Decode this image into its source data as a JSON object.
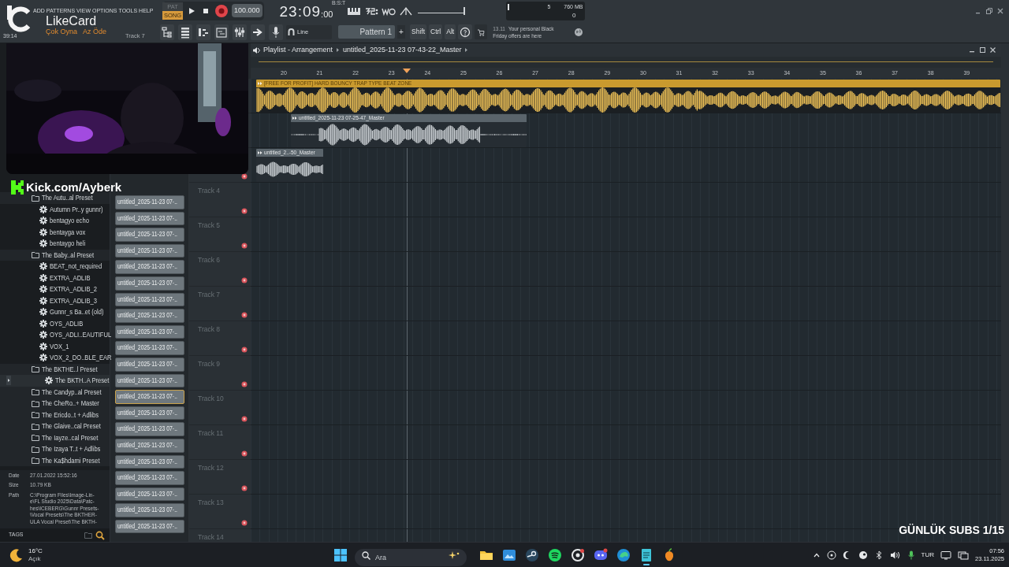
{
  "menu": [
    "ADD",
    "PATTERNS",
    "VIEW",
    "OPTIONS",
    "TOOLS",
    "HELP"
  ],
  "overlay_logo": {
    "name": "LikeCard",
    "tagline_1": "Çok Oyna",
    "tagline_2": "Az Öde"
  },
  "hint": {
    "time": "39:14",
    "track": "Track 7"
  },
  "transport": {
    "modes": [
      {
        "label": "PAT",
        "selected": false
      },
      {
        "label": "SONG",
        "selected": true
      }
    ],
    "tempo": "100.000",
    "time": "23:09",
    "time_small": ":00",
    "time_format": "B:S:T"
  },
  "master_slider": {
    "level": 0.97
  },
  "monitor": {
    "cpu": "5",
    "memory": "760 MB",
    "polyphony": "0"
  },
  "snap": "Line",
  "pattern": "Pattern 1",
  "pattern_add": "+",
  "modifiers": [
    "Shift",
    "Ctrl",
    "Alt"
  ],
  "news": {
    "date": "13.11",
    "text": "Your personal Black Friday offers are here"
  },
  "browser": {
    "items": [
      {
        "kind": "folder",
        "label": "The Autu..al Preset",
        "selected": false,
        "children": [
          {
            "kind": "preset",
            "label": "Autumn Pr..y gunnr)",
            "selected": false
          },
          {
            "kind": "preset",
            "label": "bentagyo echo",
            "selected": false
          },
          {
            "kind": "preset",
            "label": "bentayga vox",
            "selected": false
          },
          {
            "kind": "preset",
            "label": "bentaygo heli",
            "selected": false
          }
        ]
      },
      {
        "kind": "folder",
        "label": "The Baby..al Preset",
        "selected": false,
        "children": [
          {
            "kind": "preset",
            "label": "BEAT_not_required",
            "selected": false
          },
          {
            "kind": "preset",
            "label": "EXTRA_ADLIB",
            "selected": false
          },
          {
            "kind": "preset",
            "label": "EXTRA_ADLIB_2",
            "selected": false
          },
          {
            "kind": "preset",
            "label": "EXTRA_ADLIB_3",
            "selected": false
          },
          {
            "kind": "preset",
            "label": "Gunnr_s Ba..et (old)",
            "selected": false
          },
          {
            "kind": "preset",
            "label": "OYS_ADLIB",
            "selected": false
          },
          {
            "kind": "preset",
            "label": "OYS_ADLI..EAUTIFUL",
            "selected": false
          },
          {
            "kind": "preset",
            "label": "VOX_1",
            "selected": false
          },
          {
            "kind": "preset",
            "label": "VOX_2_DO..BLE_EAR",
            "selected": false
          }
        ]
      },
      {
        "kind": "folder",
        "label": "The BKTHE..l Preset",
        "selected": false,
        "children": [
          {
            "kind": "preset",
            "label": "The BKTH..A Preset",
            "selected": true
          }
        ]
      },
      {
        "kind": "folder",
        "label": "The Candyp..al Preset",
        "selected": false
      },
      {
        "kind": "folder",
        "label": "The CheRo..+ Master",
        "selected": false
      },
      {
        "kind": "folder",
        "label": "The Ericdo..t + Adlibs",
        "selected": false
      },
      {
        "kind": "folder",
        "label": "The Glaive..cal Preset",
        "selected": false
      },
      {
        "kind": "folder",
        "label": "The Iayze..cal Preset",
        "selected": false
      },
      {
        "kind": "folder",
        "label": "The Izaya T..t + Adlibs",
        "selected": false
      },
      {
        "kind": "folder",
        "label": "The Ka$hdami Preset",
        "selected": false
      }
    ],
    "info": {
      "date_label": "Date",
      "date": "27.01.2022 15:52:16",
      "size_label": "Size",
      "size": "10.79 KB",
      "path_label": "Path",
      "path_lines": [
        "C:\\Program Files\\Image-Lin-",
        "e\\FL Studio 2025\\Data\\Patc-",
        "hes\\ICEBERG\\Gunnr Presets-",
        "\\Vocal Presets\\The BKTHER-",
        "ULA Vocal Preset\\The BKTH-"
      ]
    },
    "tags": "TAGS"
  },
  "clips": [
    {
      "label": "untitled_2025-11-23 07-..",
      "selected": false
    },
    {
      "label": "untitled_2025-11-23 07-..",
      "selected": false
    },
    {
      "label": "untitled_2025-11-23 07-..",
      "selected": false
    },
    {
      "label": "untitled_2025-11-23 07-..",
      "selected": false
    },
    {
      "label": "untitled_2025-11-23 07-..",
      "selected": false
    },
    {
      "label": "untitled_2025-11-23 07-..",
      "selected": false
    },
    {
      "label": "untitled_2025-11-23 07-..",
      "selected": false
    },
    {
      "label": "untitled_2025-11-23 07-..",
      "selected": false
    },
    {
      "label": "untitled_2025-11-23 07-..",
      "selected": false
    },
    {
      "label": "untitled_2025-11-23 07-..",
      "selected": false
    },
    {
      "label": "untitled_2025-11-23 07-..",
      "selected": false
    },
    {
      "label": "untitled_2025-11-23 07-..",
      "selected": false
    },
    {
      "label": "untitled_2025-11-23 07-..",
      "selected": true
    },
    {
      "label": "untitled_2025-11-23 07-..",
      "selected": false
    },
    {
      "label": "untitled_2025-11-23 07-..",
      "selected": false
    },
    {
      "label": "untitled_2025-11-23 07-..",
      "selected": false
    },
    {
      "label": "untitled_2025-11-23 07-..",
      "selected": false
    },
    {
      "label": "untitled_2025-11-23 07-..",
      "selected": false
    },
    {
      "label": "untitled_2025-11-23 07-..",
      "selected": false
    },
    {
      "label": "untitled_2025-11-23 07-..",
      "selected": false
    },
    {
      "label": "untitled_2025-11-23 07-..",
      "selected": false
    }
  ],
  "playlist": {
    "title": "Playlist - Arrangement",
    "breadcrumb": "untitled_2025-11-23 07-43-22_Master",
    "ruler": [
      "20",
      "21",
      "22",
      "23",
      "24",
      "25",
      "26",
      "27",
      "28",
      "29",
      "30",
      "31",
      "32",
      "33",
      "34",
      "35",
      "36",
      "37",
      "38",
      "39"
    ],
    "tracks": [
      {
        "clip": {
          "label": "[FREE FOR PROFIT] HARD BOUNCY TRAP TYPE BEAT ZONE",
          "color": "#e9bd55"
        }
      },
      {
        "clip": {
          "label": "untitled_2025-11-23 07-25-47_Master",
          "color": "#c5cace"
        }
      },
      {
        "clip": {
          "label": "untitled_2..-50_Master",
          "color": "#c5cace"
        }
      },
      {
        "label": "Track 4"
      },
      {
        "label": "Track 5"
      },
      {
        "label": "Track 6"
      },
      {
        "label": "Track 7"
      },
      {
        "label": "Track 8"
      },
      {
        "label": "Track 9"
      },
      {
        "label": "Track 10"
      },
      {
        "label": "Track 11"
      },
      {
        "label": "Track 12"
      },
      {
        "label": "Track 13"
      },
      {
        "label": "Track 14"
      }
    ]
  },
  "stream_overlay": {
    "channel": "Kick.com/Ayberk",
    "subs": "GÜNLÜK SUBS 1/15"
  },
  "taskbar": {
    "temperature": "16°C",
    "condition": "Açık",
    "search_placeholder": "Ara",
    "language": "TUR",
    "time": "07:56",
    "date": "23.11.2025"
  }
}
